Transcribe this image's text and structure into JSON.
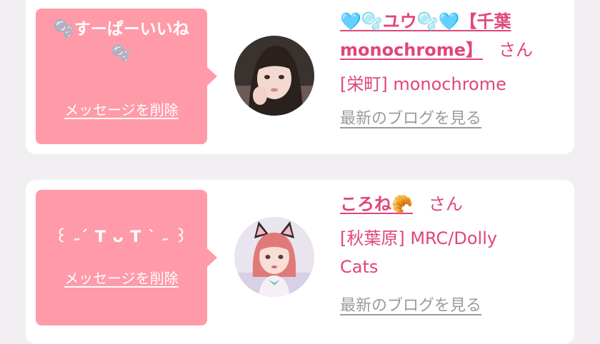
{
  "messages": [
    {
      "bubble_text_1": "🫧すーぱーいいね",
      "bubble_text_2": "🫧",
      "delete_label": "メッセージを削除",
      "name_1": "🩵🫧ユウ🫧🩵【千葉",
      "name_2": "monochrome】",
      "honorific": "さん",
      "shop": "[栄町] monochrome",
      "blog_link": "最新のブログを見る"
    },
    {
      "bubble_text_1": "꒰ ˶´ T ᴗ T ` ˶ ꒱",
      "delete_label": "メッセージを削除",
      "name_1": "ころね🥐",
      "honorific": "さん",
      "shop_1": "[秋葉原] MRC/Dolly",
      "shop_2": "Cats",
      "blog_link": "最新のブログを見る"
    }
  ],
  "colors": {
    "accent": "#e0467a",
    "bubble": "#ff9aa8",
    "link_gray": "#9b9b9b",
    "background": "#f1eff1"
  }
}
